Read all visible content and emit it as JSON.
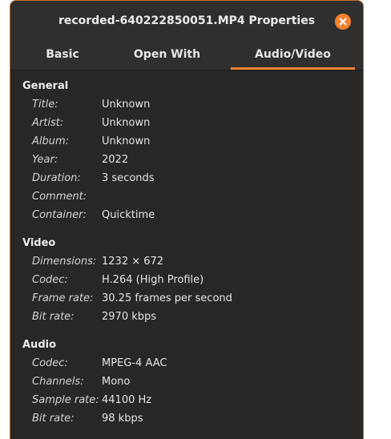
{
  "window": {
    "title": "recorded-640222850051.MP4 Properties"
  },
  "tabs": [
    {
      "label": "Basic",
      "active": false
    },
    {
      "label": "Open With",
      "active": false
    },
    {
      "label": "Audio/Video",
      "active": true
    }
  ],
  "general": {
    "heading": "General",
    "rows": [
      {
        "key": "Title:",
        "value": "Unknown"
      },
      {
        "key": "Artist:",
        "value": "Unknown"
      },
      {
        "key": "Album:",
        "value": "Unknown"
      },
      {
        "key": "Year:",
        "value": "2022"
      },
      {
        "key": "Duration:",
        "value": "3 seconds"
      },
      {
        "key": "Comment:",
        "value": ""
      },
      {
        "key": "Container:",
        "value": "Quicktime"
      }
    ]
  },
  "video": {
    "heading": "Video",
    "rows": [
      {
        "key": "Dimensions:",
        "value": "1232 × 672"
      },
      {
        "key": "Codec:",
        "value": "H.264 (High Profile)"
      },
      {
        "key": "Frame rate:",
        "value": "30.25 frames per second"
      },
      {
        "key": "Bit rate:",
        "value": "2970 kbps"
      }
    ]
  },
  "audio": {
    "heading": "Audio",
    "rows": [
      {
        "key": "Codec:",
        "value": "MPEG-4 AAC"
      },
      {
        "key": "Channels:",
        "value": "Mono"
      },
      {
        "key": "Sample rate:",
        "value": "44100 Hz"
      },
      {
        "key": "Bit rate:",
        "value": "98 kbps"
      }
    ]
  },
  "colors": {
    "accent": "#f6822d",
    "window_bg": "#2f2f2f",
    "content_bg": "#272727"
  }
}
